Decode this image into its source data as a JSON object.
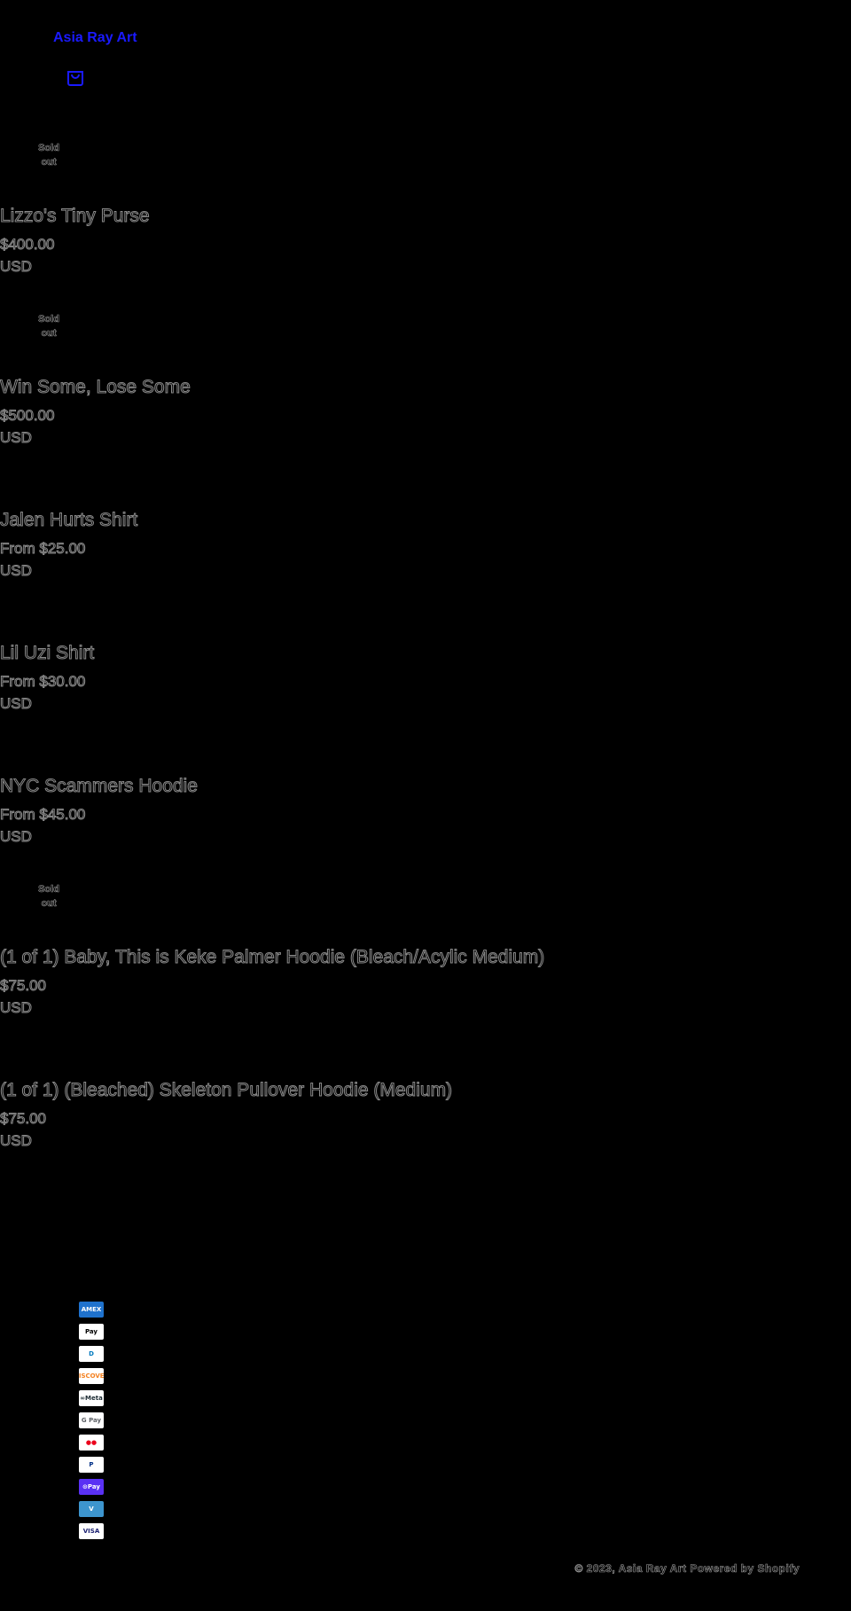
{
  "header": {
    "brand": "Asia Ray Art",
    "cart_icon": "shopping-bag-icon",
    "accent": "#1a1aff"
  },
  "products": [
    {
      "badge": "Sold out",
      "title": "Lizzo's Tiny Purse",
      "price": "$400.00",
      "currency": "USD"
    },
    {
      "badge": "Sold out",
      "title": "Win Some, Lose Some",
      "price": "$500.00",
      "currency": "USD"
    },
    {
      "badge": "",
      "title": "Jalen Hurts Shirt",
      "price": "From $25.00",
      "currency": "USD"
    },
    {
      "badge": "",
      "title": "Lil Uzi Shirt",
      "price": "From $30.00",
      "currency": "USD"
    },
    {
      "badge": "",
      "title": "NYC Scammers Hoodie",
      "price": "From $45.00",
      "currency": "USD"
    },
    {
      "badge": "Sold out",
      "title": "(1 of 1) Baby, This is Keke Palmer Hoodie (Bleach/Acylic Medium)",
      "price": "$75.00",
      "currency": "USD"
    },
    {
      "badge": "",
      "title": "(1 of 1) (Bleached) Skeleton Pullover Hoodie (Medium)",
      "price": "$75.00",
      "currency": "USD"
    }
  ],
  "payments": [
    {
      "name": "american-express-icon",
      "label": "AMEX",
      "bg": "#1f72cd",
      "fg": "#ffffff"
    },
    {
      "name": "apple-pay-icon",
      "label": " Pay",
      "bg": "#ffffff",
      "fg": "#000000"
    },
    {
      "name": "diners-club-icon",
      "label": "D",
      "bg": "#ffffff",
      "fg": "#0079be"
    },
    {
      "name": "discover-icon",
      "label": "DISCOVER",
      "bg": "#ffffff",
      "fg": "#f48120"
    },
    {
      "name": "meta-pay-icon",
      "label": "∞Meta",
      "bg": "#ffffff",
      "fg": "#1c2b33"
    },
    {
      "name": "google-pay-icon",
      "label": "G Pay",
      "bg": "#ffffff",
      "fg": "#5f6368"
    },
    {
      "name": "mastercard-icon",
      "label": "●●",
      "bg": "#ffffff",
      "fg": "#eb001b"
    },
    {
      "name": "paypal-icon",
      "label": "P",
      "bg": "#ffffff",
      "fg": "#003087"
    },
    {
      "name": "shop-pay-icon",
      "label": "⊙Pay",
      "bg": "#5a31f4",
      "fg": "#ffffff"
    },
    {
      "name": "venmo-icon",
      "label": "V",
      "bg": "#3d95ce",
      "fg": "#ffffff"
    },
    {
      "name": "visa-icon",
      "label": "VISA",
      "bg": "#ffffff",
      "fg": "#1a1f71"
    }
  ],
  "footer": {
    "copyright": "© 2023, Asia Ray Art Powered by Shopify"
  }
}
